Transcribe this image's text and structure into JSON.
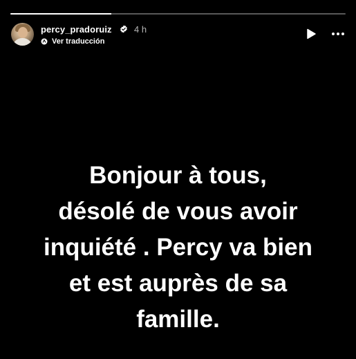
{
  "story": {
    "progress": 0.3,
    "username": "percy_pradoruiz",
    "verified": true,
    "time_ago": "4 h",
    "translate_label": "Ver traducción",
    "message": "Bonjour à tous,\ndésolé de vous avoir\ninquiété . Percy va bien\net est auprès de sa\nfamille.",
    "icons": {
      "verified": "verified-badge-icon",
      "translate": "translate-icon",
      "play": "play-icon",
      "more": "more-options-icon"
    },
    "colors": {
      "background": "#000000",
      "text": "#ffffff",
      "progress_track": "rgba(255,255,255,0.35)",
      "progress_fill": "#ffffff"
    }
  }
}
